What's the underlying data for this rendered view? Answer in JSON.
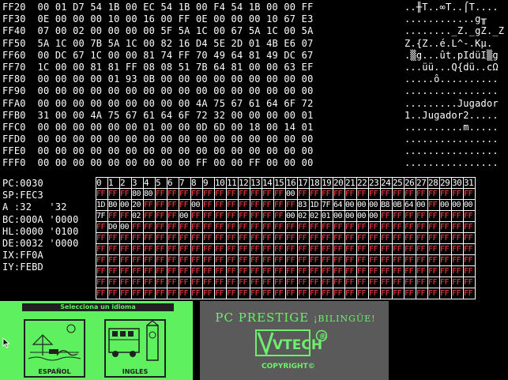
{
  "hex_rows": [
    "FF20  00 01 D7 54 1B 00 EC 54 1B 00 F4 54 1B 00 00 FF",
    "FF30  0E 00 00 00 10 00 16 00 FF 0E 00 00 00 10 67 E3",
    "FF40  07 00 02 00 00 00 00 5F 5A 1C 00 67 5A 1C 00 5A",
    "FF50  5A 1C 00 7B 5A 1C 00 82 16 D4 5E 2D 01 4B E6 07",
    "FF60  00 DC 67 1C 00 00 81 74 FF 70 49 64 81 49 DC 67",
    "FF70  1C 00 00 81 81 FF 08 08 51 7B 64 81 00 00 63 EF",
    "FF80  00 00 00 00 01 93 0B 00 00 00 00 00 00 00 00 00",
    "FF90  00 00 00 00 00 00 00 00 00 00 00 00 00 00 00 00",
    "FFA0  00 00 00 00 00 00 00 00 00 4A 75 67 61 64 6F 72",
    "FFB0  31 00 00 4A 75 67 61 64 6F 72 32 00 00 00 00 01",
    "FFC0  00 00 00 00 00 00 01 00 00 0D 6D 00 18 00 14 01",
    "FFD0  00 00 00 00 00 00 00 00 00 00 00 00 00 00 00 00",
    "FFE0  00 00 00 00 00 00 00 00 00 00 00 00 00 00 00 00",
    "FFF0  00 00 00 00 00 00 00 00 00 FF 00 00 FF 00 00 00"
  ],
  "ascii_rows": [
    "..╫T..∞T..⌠T....",
    "............g╥",
    "........_Z._gZ._Z",
    "Z.{Z..é.L^-.Kµ.",
    ".▒g...ût.pIdüI▒g",
    "...üü...Q{dü..cΩ",
    ".....ô..........",
    "................",
    ".........Jugador",
    "1..Jugador2.....",
    "..........m.....",
    "................",
    "................",
    "................"
  ],
  "registers": [
    "PC:0030",
    "SP:FEC3",
    "A :32   '32",
    "BC:000A '0000",
    "HL:0000 '0100",
    "DE:0032 '0000",
    "IX:FF0A",
    "IY:FEBD"
  ],
  "grid_header": [
    "0",
    "1",
    "2",
    "3",
    "4",
    "5",
    "6",
    "7",
    "8",
    "9",
    "10",
    "11",
    "12",
    "13",
    "14",
    "15",
    "16",
    "17",
    "18",
    "19",
    "20",
    "21",
    "22",
    "23",
    "24",
    "25",
    "26",
    "27",
    "28",
    "29",
    "30",
    "31"
  ],
  "grid_rows": [
    [
      "FF",
      "FF",
      "FF",
      "80",
      "80",
      "FF",
      "FF",
      "FF",
      "FF",
      "FF",
      "FF",
      "FF",
      "FF",
      "FF",
      "FF",
      "FF",
      "00",
      "FF",
      "FF",
      "FF",
      "FF",
      "FF",
      "FF",
      "FF",
      "FF",
      "FF",
      "FF",
      "FF",
      "FF",
      "FF",
      "FF",
      "FF"
    ],
    [
      "1D",
      "B0",
      "00",
      "20",
      "FF",
      "FF",
      "FF",
      "FF",
      "00",
      "FF",
      "FF",
      "FF",
      "FF",
      "FF",
      "FF",
      "FF",
      "FF",
      "83",
      "1D",
      "7F",
      "64",
      "00",
      "00",
      "00",
      "B8",
      "0B",
      "64",
      "00",
      "FF",
      "00",
      "00",
      "00"
    ],
    [
      "7F",
      "FF",
      "FF",
      "02",
      "FF",
      "FF",
      "FF",
      "00",
      "FF",
      "FF",
      "FF",
      "FF",
      "FF",
      "FF",
      "FF",
      "FF",
      "00",
      "02",
      "02",
      "01",
      "00",
      "00",
      "00",
      "00",
      "FF",
      "FF",
      "FF",
      "FF",
      "FF",
      "FF",
      "FF",
      "FF"
    ],
    [
      "FF",
      "D0",
      "00",
      "FF",
      "FF",
      "FF",
      "FF",
      "FF",
      "FF",
      "FF",
      "FF",
      "FF",
      "FF",
      "FF",
      "FF",
      "FF",
      "FF",
      "FF",
      "FF",
      "FF",
      "FF",
      "FF",
      "FF",
      "FF",
      "FF",
      "FF",
      "FF",
      "FF",
      "FF",
      "FF",
      "FF",
      "FF"
    ],
    [
      "FF",
      "FF",
      "FF",
      "FF",
      "FF",
      "FF",
      "FF",
      "FF",
      "FF",
      "FF",
      "FF",
      "FF",
      "FF",
      "FF",
      "FF",
      "FF",
      "FF",
      "FF",
      "FF",
      "FF",
      "FF",
      "FF",
      "FF",
      "FF",
      "FF",
      "FF",
      "FF",
      "FF",
      "FF",
      "FF",
      "FF",
      "FF"
    ],
    [
      "FF",
      "FF",
      "FF",
      "FF",
      "FF",
      "FF",
      "FF",
      "FF",
      "FF",
      "FF",
      "FF",
      "FF",
      "FF",
      "FF",
      "FF",
      "FF",
      "FF",
      "FF",
      "FF",
      "FF",
      "FF",
      "FF",
      "FF",
      "FF",
      "FF",
      "FF",
      "FF",
      "FF",
      "FF",
      "FF",
      "FF",
      "FF"
    ],
    [
      "FF",
      "FF",
      "FF",
      "FF",
      "FF",
      "FF",
      "FF",
      "FF",
      "FF",
      "FF",
      "FF",
      "FF",
      "FF",
      "FF",
      "FF",
      "FF",
      "FF",
      "FF",
      "FF",
      "FF",
      "FF",
      "FF",
      "FF",
      "FF",
      "FF",
      "FF",
      "FF",
      "FF",
      "FF",
      "FF",
      "FF",
      "FF"
    ],
    [
      "FF",
      "FF",
      "FF",
      "FF",
      "FF",
      "FF",
      "FF",
      "FF",
      "FF",
      "FF",
      "FF",
      "FF",
      "FF",
      "FF",
      "FF",
      "FF",
      "FF",
      "FF",
      "FF",
      "FF",
      "FF",
      "FF",
      "FF",
      "FF",
      "FF",
      "FF",
      "FF",
      "FF",
      "FF",
      "FF",
      "FF",
      "FF"
    ],
    [
      "FF",
      "FF",
      "FF",
      "FF",
      "FF",
      "FF",
      "FF",
      "FF",
      "FF",
      "FF",
      "FF",
      "FF",
      "FF",
      "FF",
      "FF",
      "FF",
      "FF",
      "FF",
      "FF",
      "FF",
      "FF",
      "FF",
      "FF",
      "FF",
      "FF",
      "FF",
      "FF",
      "FF",
      "FF",
      "FF",
      "FF",
      "FF"
    ],
    [
      "FF",
      "FF",
      "FF",
      "FF",
      "FF",
      "FF",
      "FF",
      "FF",
      "FF",
      "FF",
      "FF",
      "FF",
      "FF",
      "FF",
      "FF",
      "FF",
      "FF",
      "FF",
      "FF",
      "FF",
      "FF",
      "FF",
      "FF",
      "FF",
      "FF",
      "FF",
      "FF",
      "FF",
      "FF",
      "FF",
      "FF",
      "FF"
    ]
  ],
  "emulator": {
    "language_title": "Selecciona un idioma",
    "option_spanish": "ESPAÑOL",
    "option_english": "INGLES",
    "product_title": "PC PRESTIGE",
    "product_subtitle": "¡BILINGÜE!",
    "brand": "VTECH",
    "copyright": "COPYRIGHT©",
    "registered_mark": "®"
  },
  "colors": {
    "background": "#000000",
    "text": "#ffffff",
    "grid_highlight": "#ff4040",
    "screen_green": "#5ef05e",
    "screen_gray": "#5a5a5a"
  }
}
